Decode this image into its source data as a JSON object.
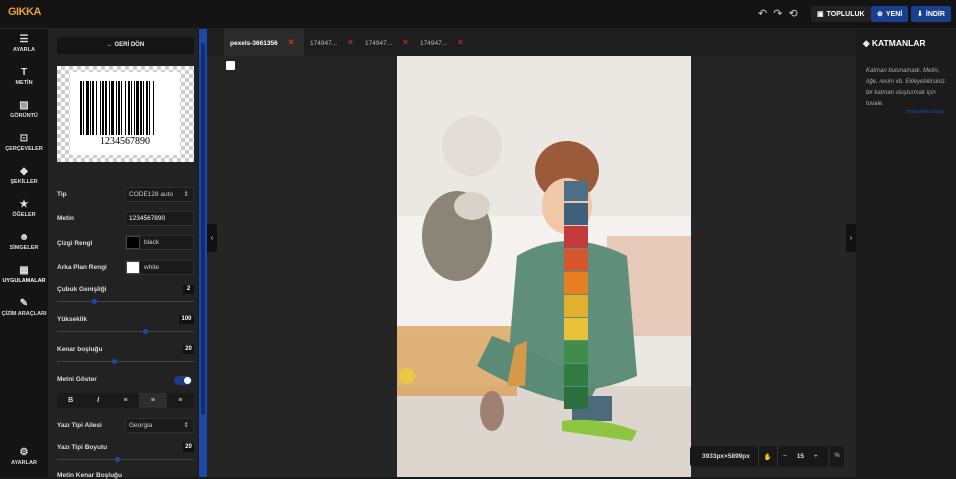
{
  "app": {
    "logo": "GIKKA"
  },
  "toolbar": {
    "community_label": "TOPLULUK",
    "new_label": "YENİ",
    "download_label": "İNDİR"
  },
  "nav": {
    "items": [
      {
        "label": "AYARLA",
        "icon": "sliders-icon"
      },
      {
        "label": "METİN",
        "icon": "text-icon"
      },
      {
        "label": "GÖRÜNTÜ",
        "icon": "image-icon"
      },
      {
        "label": "ÇERÇEVELER",
        "icon": "frame-icon"
      },
      {
        "label": "ŞEKİLLER",
        "icon": "shapes-icon"
      },
      {
        "label": "ÖĞELER",
        "icon": "star-icon"
      },
      {
        "label": "SİMGELER",
        "icon": "emoji-icon"
      },
      {
        "label": "UYGULAMALAR",
        "icon": "grid-icon"
      },
      {
        "label": "ÇİZİM ARAÇLARI",
        "icon": "brush-icon"
      }
    ],
    "settings_label": "AYARLAR"
  },
  "panel": {
    "back_label": "← GERİ DÖN",
    "barcode_number": "1234567890",
    "type_label": "Tip",
    "type_value": "CODE128 auto",
    "text_label": "Metin",
    "text_value": "1234567890",
    "line_color_label": "Çizgi Rengi",
    "line_color_value": "black",
    "bg_color_label": "Arka Plan Rengi",
    "bg_color_value": "white",
    "bar_width_label": "Çubuk Genişliği",
    "bar_width_value": "2",
    "height_label": "Yükseklik",
    "height_value": "100",
    "margin_label": "Kenar boşluğu",
    "margin_value": "20",
    "show_text_label": "Metni Göster",
    "show_text_on": true,
    "format_buttons": [
      "B",
      "I",
      "≡",
      "≡",
      "≡"
    ],
    "font_family_label": "Yazı Tipi Ailesi",
    "font_family_value": "Georgia",
    "font_size_label": "Yazı Tipi Boyutu",
    "font_size_value": "20",
    "text_margin_label": "Metin Kenar Boşluğu"
  },
  "tabs": [
    {
      "label": "pexels-3661356",
      "active": true
    },
    {
      "label": "174947...",
      "active": false
    },
    {
      "label": "174947...",
      "active": false
    },
    {
      "label": "174947...",
      "active": false
    }
  ],
  "canvas": {
    "dimensions": "3933px×5899px",
    "zoom": "15",
    "zoom_unit": "%"
  },
  "layers": {
    "title": "KATMANLAR",
    "empty_text": "Katman bulunamadı. Metin, öğe, resim vb. Ekleyebilirsiniz. bir katman oluşturmak için tuvale.",
    "link_text": "tıklayarak başla"
  },
  "colors": {
    "accent": "#1c4aa8",
    "tab_close": "#e0302a"
  }
}
